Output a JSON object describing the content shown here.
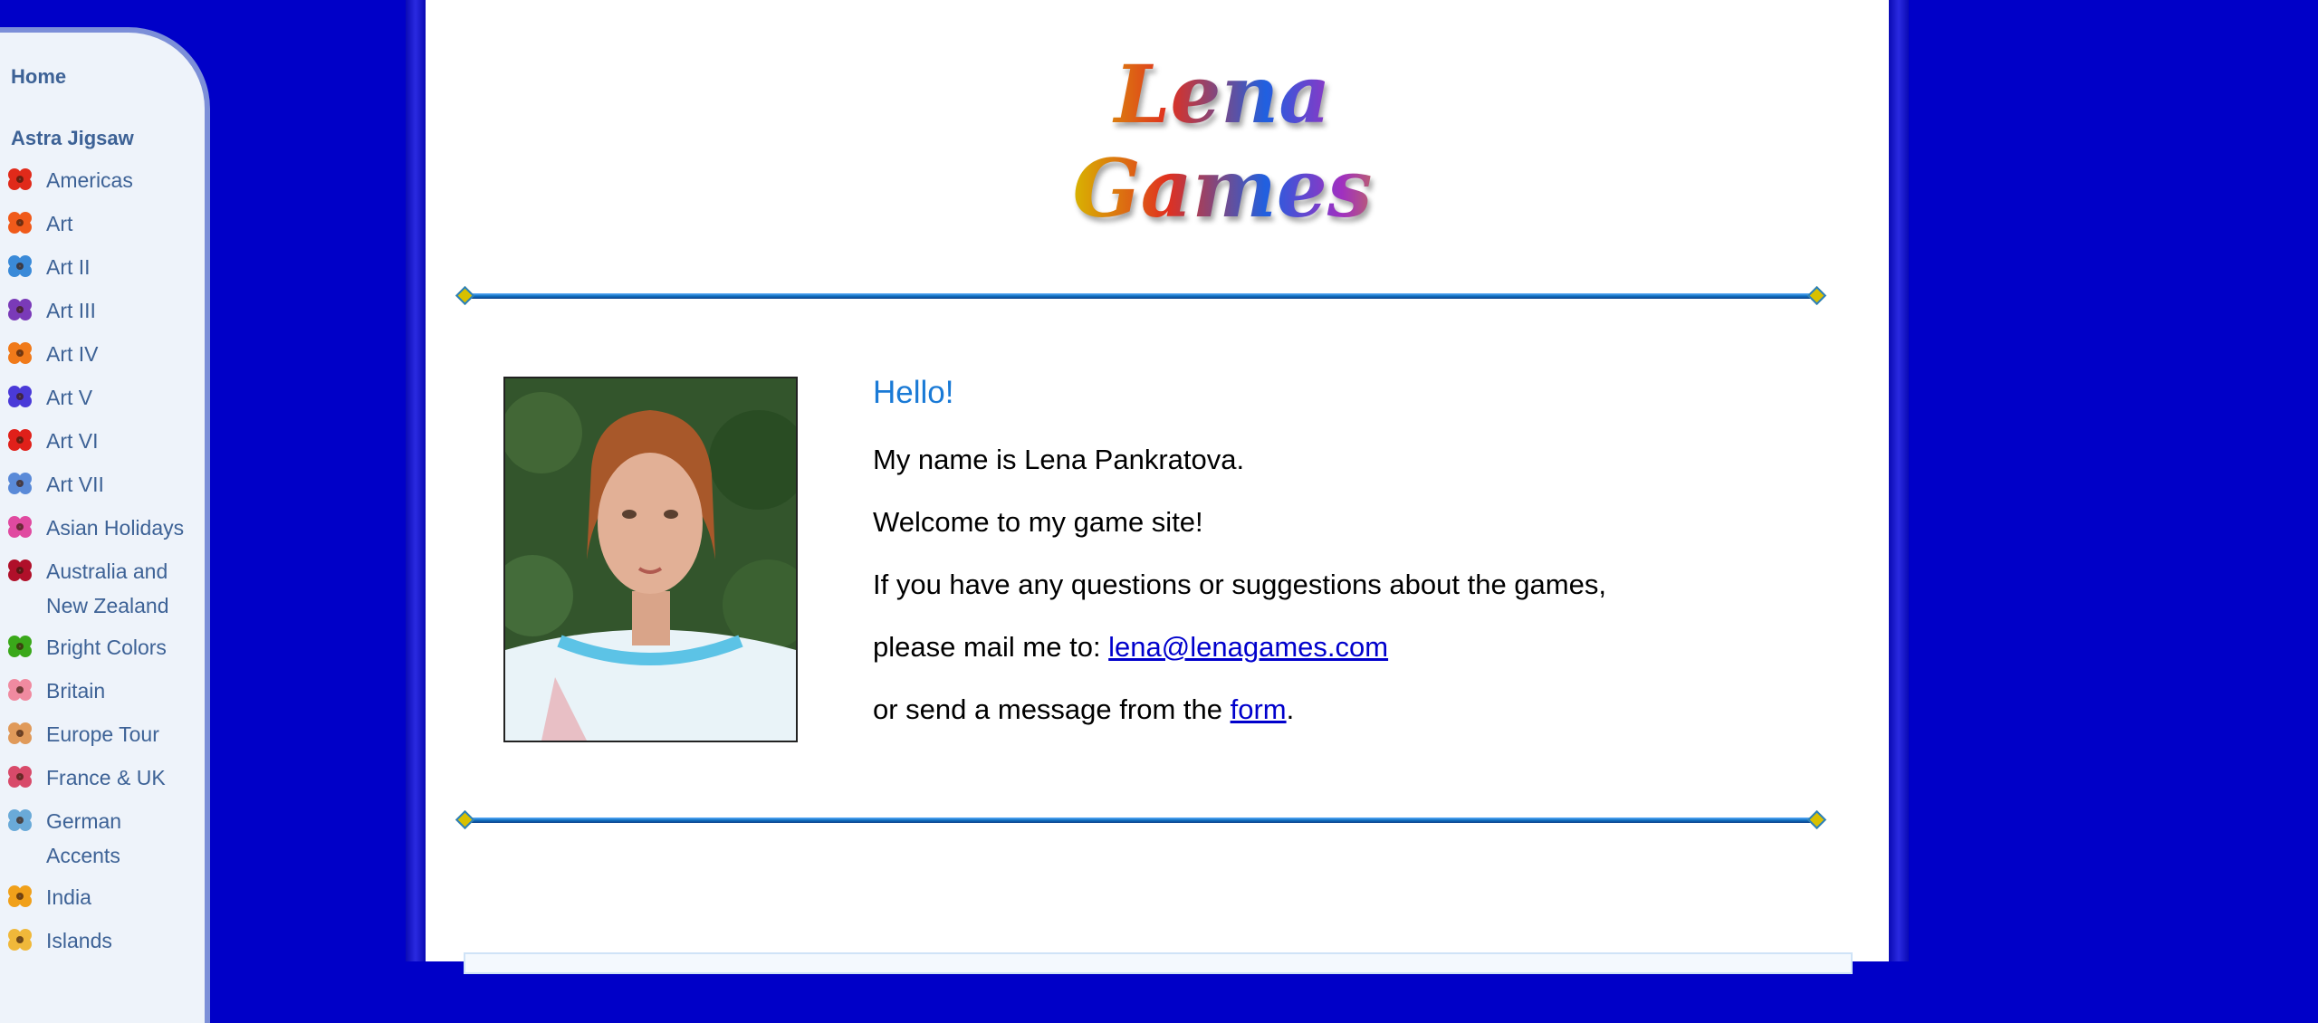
{
  "sidebar": {
    "home_label": "Home",
    "section_label": "Astra Jigsaw",
    "items": [
      {
        "label": "Americas",
        "icon": "red-flower-icon",
        "color": "#e02a1a"
      },
      {
        "label": "Art",
        "icon": "orange-flower-icon",
        "color": "#f05a1a"
      },
      {
        "label": "Art II",
        "icon": "blue-flower-icon",
        "color": "#3a8ad8"
      },
      {
        "label": "Art III",
        "icon": "purple-flower-icon",
        "color": "#7a3ab8"
      },
      {
        "label": "Art IV",
        "icon": "orange-lily-icon",
        "color": "#f07a1a"
      },
      {
        "label": "Art V",
        "icon": "violet-flower-icon",
        "color": "#4a3ad8"
      },
      {
        "label": "Art VI",
        "icon": "poppy-icon",
        "color": "#e0201a"
      },
      {
        "label": "Art VII",
        "icon": "blue-star-icon",
        "color": "#5a8ad8"
      },
      {
        "label": "Asian Holidays",
        "icon": "pink-flower-icon",
        "color": "#e04aa0"
      },
      {
        "label": "Australia and New Zealand",
        "icon": "crimson-flower-icon",
        "color": "#b0102a"
      },
      {
        "label": "Bright Colors",
        "icon": "green-flower-icon",
        "color": "#3aa81a"
      },
      {
        "label": "Britain",
        "icon": "pink-lips-icon",
        "color": "#f08aa0"
      },
      {
        "label": "Europe Tour",
        "icon": "peach-flower-icon",
        "color": "#e09a5a"
      },
      {
        "label": "France & UK",
        "icon": "rose-flower-icon",
        "color": "#d84a6a"
      },
      {
        "label": "German Accents",
        "icon": "blue-feather-icon",
        "color": "#6aaad8"
      },
      {
        "label": "India",
        "icon": "yellow-flower-icon",
        "color": "#f0a01a"
      },
      {
        "label": "Islands",
        "icon": "yellow-star-icon",
        "color": "#f0b83a"
      }
    ]
  },
  "header": {
    "logo_text": "Lena Games"
  },
  "content": {
    "hello": "Hello!",
    "line1": "My name is Lena Pankratova.",
    "line2": "Welcome to my game site!",
    "line3": "If you have any questions or suggestions about the games,",
    "line4_prefix": "please mail me to: ",
    "email": "lena@lenagames.com",
    "line5_prefix": "or send a message from the ",
    "form_link": "form",
    "line5_suffix": "."
  }
}
